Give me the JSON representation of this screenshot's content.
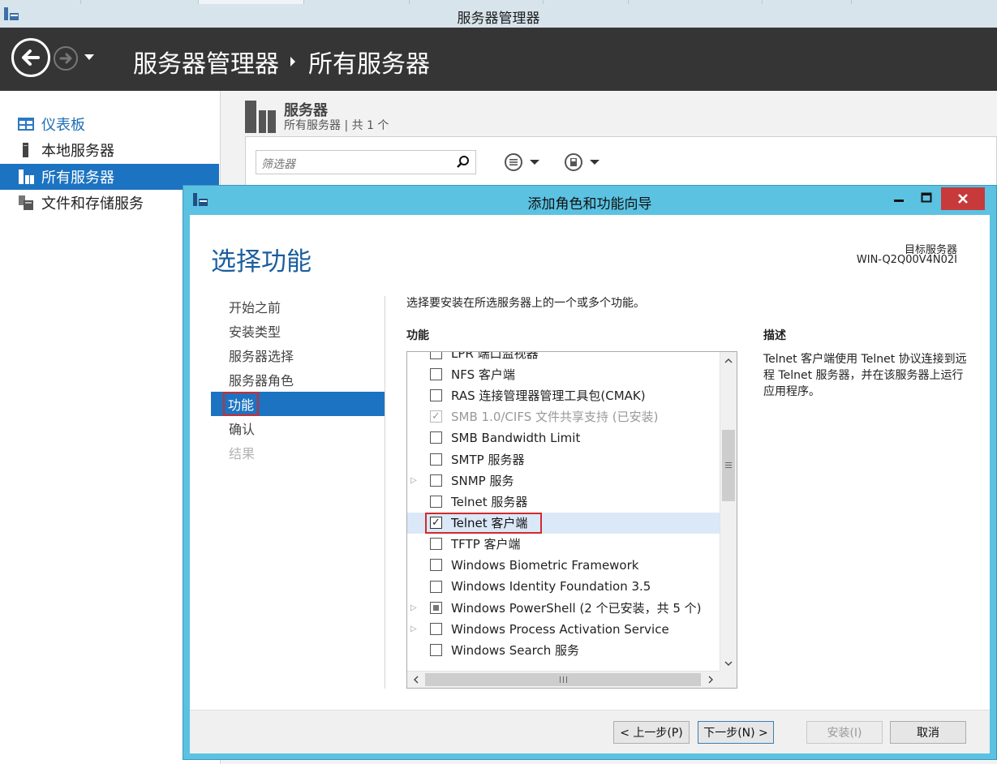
{
  "server_manager": {
    "window_title": "服务器管理器",
    "breadcrumb": {
      "root": "服务器管理器",
      "current": "所有服务器"
    },
    "sidebar": {
      "items": [
        {
          "label": "仪表板",
          "icon": "dashboard-icon"
        },
        {
          "label": "本地服务器",
          "icon": "local-server-icon"
        },
        {
          "label": "所有服务器",
          "icon": "all-servers-icon",
          "active": true
        },
        {
          "label": "文件和存储服务",
          "icon": "file-storage-icon"
        }
      ]
    },
    "tile": {
      "title": "服务器",
      "subtitle": "所有服务器 | 共 1 个"
    },
    "filter": {
      "placeholder": "筛选器"
    }
  },
  "wizard": {
    "title": "添加角色和功能向导",
    "heading": "选择功能",
    "target_label": "目标服务器",
    "target_name": "WIN-Q2Q00V4N02I",
    "steps": [
      {
        "label": "开始之前",
        "state": "normal"
      },
      {
        "label": "安装类型",
        "state": "normal"
      },
      {
        "label": "服务器选择",
        "state": "normal"
      },
      {
        "label": "服务器角色",
        "state": "normal"
      },
      {
        "label": "功能",
        "state": "active"
      },
      {
        "label": "确认",
        "state": "normal"
      },
      {
        "label": "结果",
        "state": "disabled"
      }
    ],
    "instruction": "选择要安装在所选服务器上的一个或多个功能。",
    "features_label": "功能",
    "description_label": "描述",
    "description_text": "Telnet 客户端使用 Telnet 协议连接到远程 Telnet 服务器，并在该服务器上运行应用程序。",
    "features": [
      {
        "label": "LPR 端口监视器",
        "checked": false
      },
      {
        "label": "NFS 客户端",
        "checked": false
      },
      {
        "label": "RAS 连接管理器管理工具包(CMAK)",
        "checked": false
      },
      {
        "label": "SMB 1.0/CIFS 文件共享支持 (已安装)",
        "checked": true,
        "disabled": true
      },
      {
        "label": "SMB Bandwidth Limit",
        "checked": false
      },
      {
        "label": "SMTP 服务器",
        "checked": false
      },
      {
        "label": "SNMP 服务",
        "checked": false,
        "expandable": true
      },
      {
        "label": "Telnet 服务器",
        "checked": false
      },
      {
        "label": "Telnet 客户端",
        "checked": true,
        "selected": true
      },
      {
        "label": "TFTP 客户端",
        "checked": false
      },
      {
        "label": "Windows Biometric Framework",
        "checked": false
      },
      {
        "label": "Windows Identity Foundation 3.5",
        "checked": false
      },
      {
        "label": "Windows PowerShell (2 个已安装，共 5 个)",
        "partial": true,
        "expandable": true
      },
      {
        "label": "Windows Process Activation Service",
        "checked": false,
        "expandable": true
      },
      {
        "label": "Windows Search 服务",
        "checked": false
      }
    ],
    "buttons": {
      "prev": "< 上一步(P)",
      "next": "下一步(N) >",
      "install": "安装(I)",
      "cancel": "取消"
    }
  }
}
